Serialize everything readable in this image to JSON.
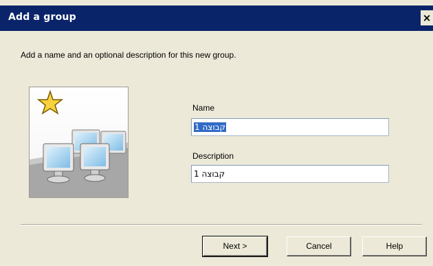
{
  "window": {
    "title": "Add a group",
    "close_glyph": "×"
  },
  "instruction": "Add a name and an optional description for this new group.",
  "illustration": {
    "icon": "group-computers-star-icon"
  },
  "form": {
    "name_label": "Name",
    "name_value": "קבוצה 1",
    "description_label": "Description",
    "description_value": "קבוצה 1"
  },
  "buttons": {
    "next": "Next >",
    "cancel": "Cancel",
    "help": "Help"
  },
  "colors": {
    "titlebar": "#0A246A",
    "dialog_bg": "#ECE9D8",
    "selection": "#316AC5",
    "star": "#F7D23E",
    "monitor_screen": "#9FD0F0"
  }
}
